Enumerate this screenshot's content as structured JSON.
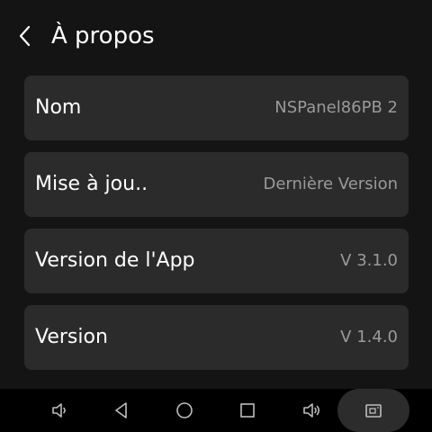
{
  "header": {
    "title": "À propos",
    "back_icon": "chevron-left-icon"
  },
  "rows": [
    {
      "label": "Nom",
      "value": "NSPanel86PB 2"
    },
    {
      "label": "Mise à jou..",
      "value": "Dernière Version"
    },
    {
      "label": "Version de l'App",
      "value": "V 3.1.0"
    },
    {
      "label": "Version",
      "value": "V 1.4.0"
    }
  ],
  "navbar": {
    "buttons": [
      {
        "icon": "volume-down-icon"
      },
      {
        "icon": "back-triangle-icon"
      },
      {
        "icon": "home-circle-icon"
      },
      {
        "icon": "recent-apps-square-icon"
      },
      {
        "icon": "volume-up-icon"
      },
      {
        "icon": "screenshot-icon"
      }
    ]
  },
  "colors": {
    "background": "#141414",
    "card": "#2b2b2b",
    "text": "#ffffff",
    "secondary_text": "#9a9a9a",
    "navbar": "#000000",
    "nav_icon": "#bdbdbd"
  }
}
